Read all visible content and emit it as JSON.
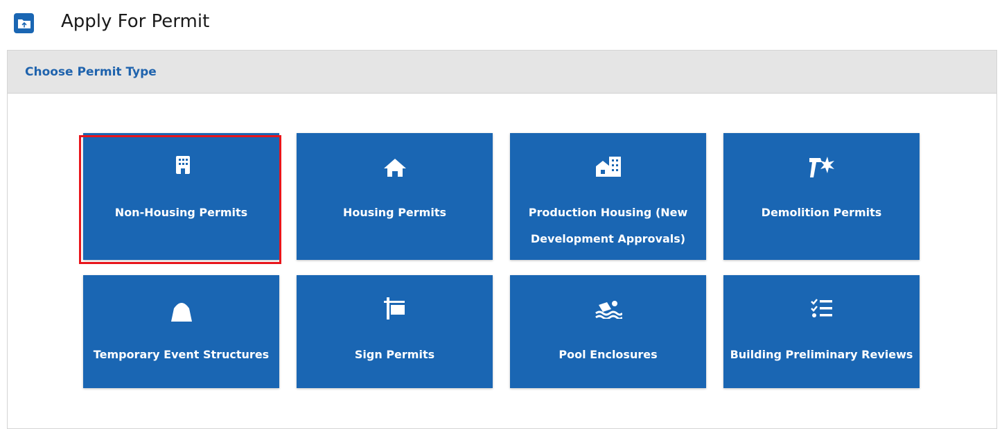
{
  "header": {
    "icon": "folder-upload-icon",
    "title": "Apply For Permit"
  },
  "panel": {
    "title": "Choose Permit Type"
  },
  "tiles": [
    {
      "label": "Non-Housing Permits",
      "icon": "office-building-icon",
      "selected": true
    },
    {
      "label": "Housing Permits",
      "icon": "house-icon",
      "selected": false
    },
    {
      "label": "Production Housing (New Development Approvals)",
      "icon": "home-city-icon",
      "selected": false
    },
    {
      "label": "Demolition Permits",
      "icon": "hammer-impact-icon",
      "selected": false
    },
    {
      "label": "Temporary Event Structures",
      "icon": "tent-icon",
      "selected": false
    },
    {
      "label": "Sign Permits",
      "icon": "sign-post-icon",
      "selected": false
    },
    {
      "label": "Pool Enclosures",
      "icon": "swimmer-icon",
      "selected": false
    },
    {
      "label": "Building Preliminary Reviews",
      "icon": "checklist-icon",
      "selected": false
    }
  ],
  "colors": {
    "tile_bg": "#1a66b3",
    "selection_outline": "#e8151b",
    "panel_title": "#1f63ad",
    "panel_header_bg": "#e5e5e5"
  }
}
